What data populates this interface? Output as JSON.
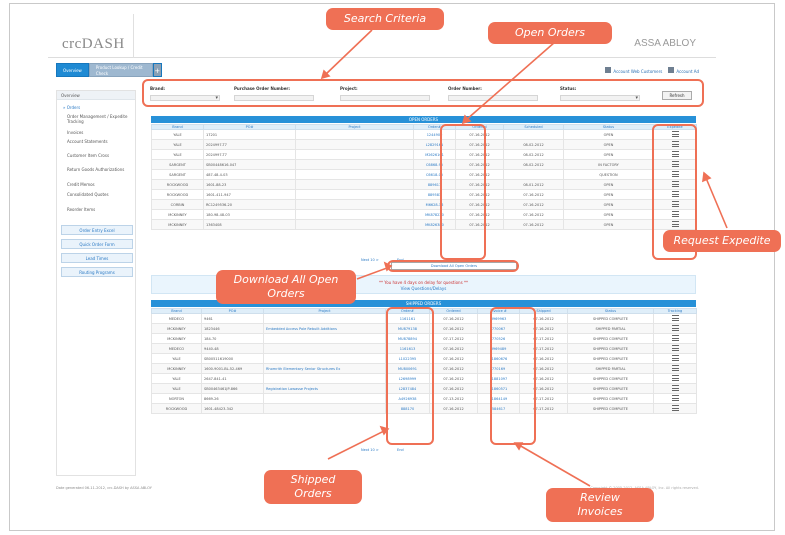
{
  "app": {
    "logo": "crcDASH",
    "brand": "ASSA ABLOY"
  },
  "tabs": [
    {
      "label": "Overview"
    },
    {
      "label": "Product Lookup / Credit Check"
    },
    {
      "label": "+"
    }
  ],
  "user_links": {
    "account": "Account Web Customers",
    "settings": "Account Ad"
  },
  "search": {
    "brand_label": "Brand:",
    "po_label": "Purchase Order Number:",
    "project_label": "Project:",
    "order_label": "Order Number:",
    "status_label": "Status:",
    "refresh_label": "Refresh"
  },
  "sidebar": {
    "header": "Overview",
    "items": [
      {
        "label": "» Orders"
      },
      {
        "label": "Order Management / Expedite Tracking"
      },
      {
        "label": "Invoices"
      },
      {
        "label": "Account Statements"
      },
      {
        "label": "Customer Item Cross"
      },
      {
        "label": "Return Goods Authorizations"
      },
      {
        "label": "Credit Memos"
      },
      {
        "label": "Consolidated Quotes"
      },
      {
        "label": "Reorder Items"
      }
    ],
    "buttons": [
      {
        "label": "Order Entry Excel"
      },
      {
        "label": "Quick Order Form"
      },
      {
        "label": "Lead Times"
      },
      {
        "label": "Routing Programs"
      }
    ]
  },
  "open_orders": {
    "title": "OPEN ORDERS",
    "columns": [
      "Brand",
      "PO#",
      "Project",
      "Order#",
      "Ordered",
      "Scheduled",
      "Status",
      "Expedite"
    ],
    "rows": [
      {
        "brand": "YALE",
        "po": "17201",
        "project": "",
        "order": "1244900",
        "ordered": "07-16-2012",
        "scheduled": "",
        "status": "OPEN"
      },
      {
        "brand": "YALE",
        "po": "2024997-T7",
        "project": "",
        "order": "L2829161",
        "ordered": "07-16-2012",
        "scheduled": "08-02-2012",
        "status": "OPEN"
      },
      {
        "brand": "YALE",
        "po": "2024997-T7",
        "project": "",
        "order": "M2626161",
        "ordered": "07-16-2012",
        "scheduled": "08-02-2012",
        "status": "OPEN"
      },
      {
        "brand": "SARGENT",
        "po": "SB00448616-047",
        "project": "",
        "order": "C6868-95",
        "ordered": "07-16-2012",
        "scheduled": "08-02-2012",
        "status": "IN FACTORY"
      },
      {
        "brand": "SARGENT",
        "po": "487-48-4-03",
        "project": "",
        "order": "C6618-05",
        "ordered": "07-16-2012",
        "scheduled": "",
        "status": "QUESTION"
      },
      {
        "brand": "ROCKWOOD",
        "po": "1601-88-23",
        "project": "",
        "order": "889617",
        "ordered": "07-16-2012",
        "scheduled": "08-01-2012",
        "status": "OPEN"
      },
      {
        "brand": "ROCKWOOD",
        "po": "1601-411-947",
        "project": "",
        "order": "889583",
        "ordered": "07-16-2012",
        "scheduled": "07-16-2012",
        "status": "OPEN"
      },
      {
        "brand": "CORBIN",
        "po": "RC1249536-20",
        "project": "",
        "order": "M6628-16",
        "ordered": "07-16-2012",
        "scheduled": "07-16-2012",
        "status": "OPEN"
      },
      {
        "brand": "MCKINNEY",
        "po": "180-98-48-03",
        "project": "",
        "order": "MK878220",
        "ordered": "07-16-2012",
        "scheduled": "07-16-2012",
        "status": "OPEN"
      },
      {
        "brand": "MCKINNEY",
        "po": "1363408",
        "project": "",
        "order": "MK826380",
        "ordered": "07-16-2012",
        "scheduled": "07-16-2012",
        "status": "OPEN"
      }
    ],
    "pager": "Next 10 >",
    "pager_end": "End"
  },
  "download_link": "Download All Open Orders",
  "notice": {
    "line1": "** You have 4 days on delay for questions **",
    "line2": "View Questions/Delays"
  },
  "shipped_orders": {
    "title": "SHIPPED ORDERS",
    "columns": [
      "Brand",
      "PO#",
      "Project",
      "Order#",
      "Ordered",
      "Invoice #",
      "Shipped",
      "Status",
      "Tracking"
    ],
    "rows": [
      {
        "brand": "MEDECO",
        "po": "9461",
        "project": "",
        "order": "1161161",
        "ordered": "07-16-2012",
        "invoice": "3969963",
        "shipped": "07-16-2012",
        "status": "SHIPPED COMPLETE"
      },
      {
        "brand": "MCKINNEY",
        "po": "1823446",
        "project": "Embedded Access Pole Rebuilt Additions",
        "order": "MU879138",
        "ordered": "07-16-2012",
        "invoice": "770067",
        "shipped": "07-16-2012",
        "status": "SHIPPED PARTIAL"
      },
      {
        "brand": "MCKINNEY",
        "po": "184-70",
        "project": "",
        "order": "MU878894",
        "ordered": "07-17-2012",
        "invoice": "770526",
        "shipped": "07-17-2012",
        "status": "SHIPPED COMPLETE"
      },
      {
        "brand": "MEDECO",
        "po": "9440-48",
        "project": "",
        "order": "1161613",
        "ordered": "07-16-2012",
        "invoice": "3969489",
        "shipped": "07-17-2012",
        "status": "SHIPPED COMPLETE"
      },
      {
        "brand": "YALE",
        "po": "SB00511619000",
        "project": "",
        "order": "L1022395",
        "ordered": "07-16-2012",
        "invoice": "L1860676",
        "shipped": "07-16-2012",
        "status": "SHIPPED COMPLETE"
      },
      {
        "brand": "MCKINNEY",
        "po": "1600-9001-BL-52-469",
        "project": "Rhomrith Elementary Senior Structures Ex",
        "order": "MU800691",
        "ordered": "07-16-2012",
        "invoice": "770169",
        "shipped": "07-16-2012",
        "status": "SHIPPED PARTIAL"
      },
      {
        "brand": "YALE",
        "po": "2647-841-41",
        "project": "",
        "order": "L2698999",
        "ordered": "07-16-2012",
        "invoice": "L1881097",
        "shipped": "07-16-2012",
        "status": "SHIPPED COMPLETE"
      },
      {
        "brand": "YALE",
        "po": "SB00463461JP-866",
        "project": "Registration Lowasse Projects",
        "order": "L2837484",
        "ordered": "07-16-2012",
        "invoice": "L1860571",
        "shipped": "07-16-2012",
        "status": "SHIPPED COMPLETE"
      },
      {
        "brand": "NORTON",
        "po": "8669-26",
        "project": "",
        "order": "A4926938",
        "ordered": "07-13-2012",
        "invoice": "L1864149",
        "shipped": "07-17-2012",
        "status": "SHIPPED COMPLETE"
      },
      {
        "brand": "ROCKWOOD",
        "po": "1601-48423-342",
        "project": "",
        "order": "888170",
        "ordered": "07-16-2012",
        "invoice": "584617",
        "shipped": "07-17-2012",
        "status": "SHIPPED COMPLETE"
      }
    ],
    "pager": "Next 10 >",
    "pager_end": "End"
  },
  "footer": {
    "left": "Date generated 06-11-2012, crc-DASH by ASSA ABLOY",
    "right": "Copyright © 2005-2012, ASSA ABLOY, Inc. All rights reserved."
  },
  "callouts": {
    "search_criteria": "Search Criteria",
    "open_orders": "Open Orders",
    "request_expedite": "Request Expedite",
    "download_all": "Download All Open Orders",
    "shipped_orders": "Shipped Orders",
    "review_invoices": "Review Invoices"
  },
  "colors": {
    "accent": "#EF7055",
    "primary": "#2791D8",
    "link": "#2A79C4"
  }
}
